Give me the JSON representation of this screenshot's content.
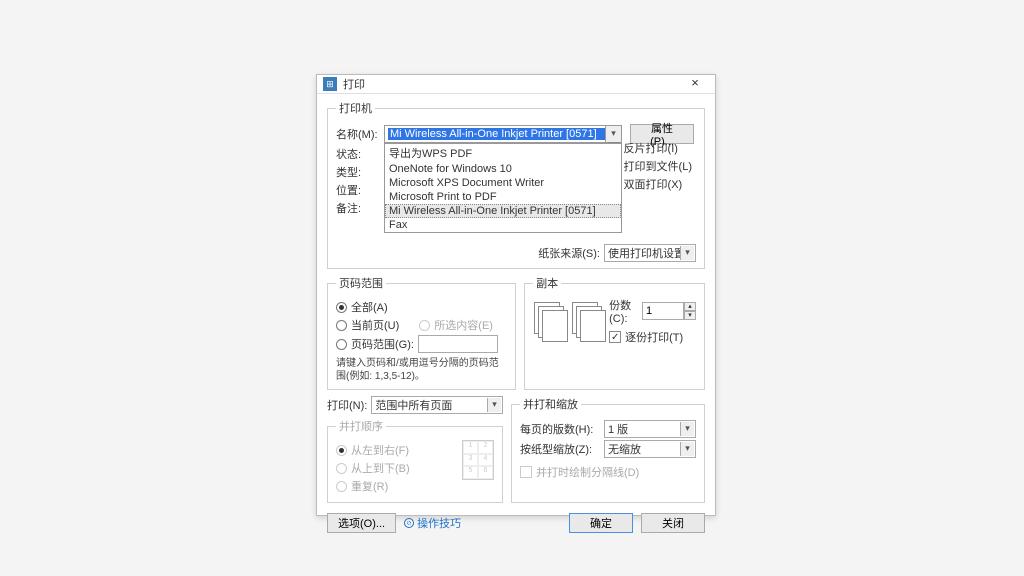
{
  "dialog": {
    "title": "打印",
    "close": "×"
  },
  "printer": {
    "legend": "打印机",
    "name_label": "名称(M):",
    "selected": "Mi Wireless All-in-One Inkjet Printer [0571]",
    "options": [
      "导出为WPS PDF",
      "OneNote for Windows 10",
      "Microsoft XPS Document Writer",
      "Microsoft Print to PDF",
      "Mi Wireless All-in-One Inkjet Printer [0571]",
      "Fax"
    ],
    "highlighted_index": 4,
    "status_label": "状态:",
    "type_label": "类型:",
    "location_label": "位置:",
    "comment_label": "备注:",
    "properties_btn": "属性(P)...",
    "checks": {
      "reverse": "反片打印(I)",
      "to_file": "打印到文件(L)",
      "duplex": "双面打印(X)"
    },
    "paper_source_label": "纸张来源(S):",
    "paper_source_value": "使用打印机设置"
  },
  "page_range": {
    "legend": "页码范围",
    "all": "全部(A)",
    "current": "当前页(U)",
    "selection": "所选内容(E)",
    "range": "页码范围(G):",
    "help": "请键入页码和/或用逗号分隔的页码范围(例如: 1,3,5-12)。"
  },
  "copies": {
    "legend": "副本",
    "count_label": "份数(C):",
    "count_value": "1",
    "collate": "逐份打印(T)"
  },
  "print_what": {
    "label": "打印(N):",
    "value": "范围中所有页面"
  },
  "order": {
    "legend": "并打顺序",
    "lr": "从左到右(F)",
    "tb": "从上到下(B)",
    "repeat": "重复(R)"
  },
  "scaling": {
    "legend": "并打和缩放",
    "per_sheet_label": "每页的版数(H):",
    "per_sheet_value": "1 版",
    "scale_label": "按纸型缩放(Z):",
    "scale_value": "无缩放",
    "draw_lines": "并打时绘制分隔线(D)"
  },
  "bottom": {
    "options": "选项(O)...",
    "tips": "操作技巧",
    "ok": "确定",
    "close": "关闭"
  }
}
